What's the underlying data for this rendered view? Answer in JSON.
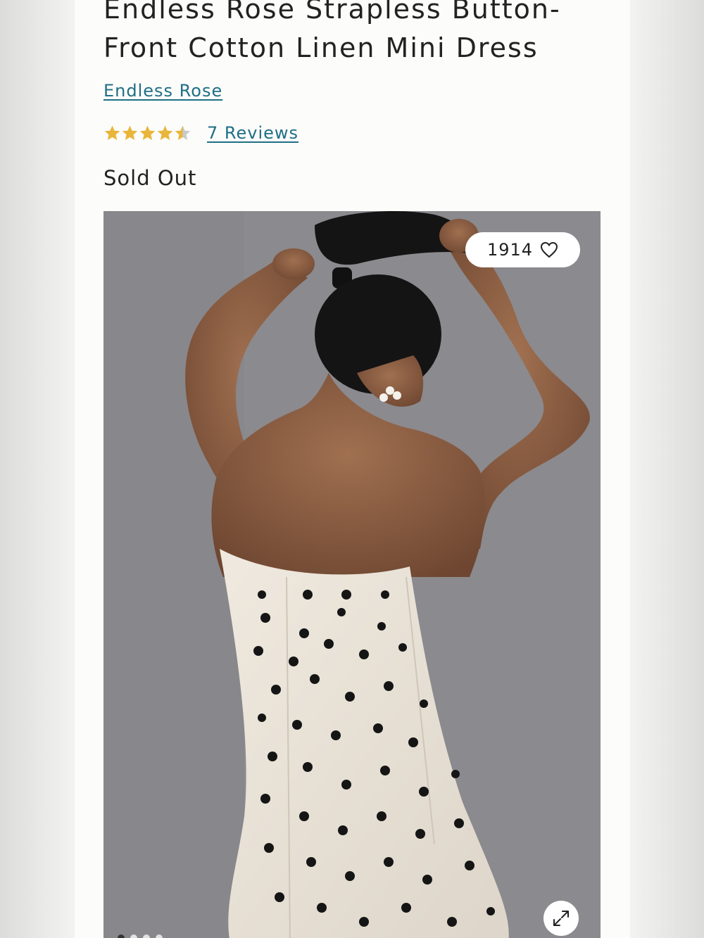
{
  "product": {
    "title": "Endless Rose Strapless Button-Front Cotton Linen Mini Dress",
    "brand": "Endless Rose",
    "rating": {
      "value": 4.5,
      "max": 5,
      "reviews_label": "7 Reviews"
    },
    "status": "Sold Out"
  },
  "gallery": {
    "like_count": "1914",
    "icons": {
      "like": "heart-icon",
      "expand": "expand-icon",
      "star": "star-icon"
    },
    "image_count": 4,
    "active_image": 1
  },
  "colors": {
    "link": "#1f6f86",
    "star": "#e9b63b",
    "star_empty": "#c9c9c9",
    "text": "#222222"
  }
}
